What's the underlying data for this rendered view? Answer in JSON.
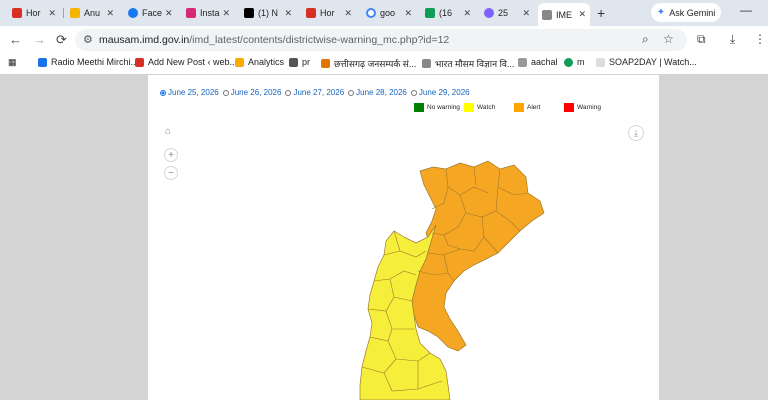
{
  "browser": {
    "tabs": [
      {
        "label": "Hor",
        "color": "#d93025"
      },
      {
        "label": "Anu",
        "color": "#f4b400"
      },
      {
        "label": "Face",
        "color": "#1877f2"
      },
      {
        "label": "Insta",
        "color": "#d62976"
      },
      {
        "label": "(1) N",
        "color": "#000000"
      },
      {
        "label": "Hor",
        "color": "#d93025"
      },
      {
        "label": "goo",
        "color": "#4285f4"
      },
      {
        "label": "(16",
        "color": "#0f9d58"
      },
      {
        "label": "25",
        "color": "#7b61ff"
      },
      {
        "label": "IME",
        "color": "#888888",
        "active": true
      }
    ],
    "new_tab": "+",
    "gemini_label": "Ask Gemini",
    "minimize": "—",
    "url_host": "mausam.imd.gov.in",
    "url_path": "/imd_latest/contents/districtwise-warning_mc.php?id=12",
    "nav": {
      "back": "←",
      "forward": "→",
      "reload": "⟳"
    }
  },
  "bookmarks": [
    {
      "label": "Radio Meethi Mirchi...",
      "color": "#1a73e8"
    },
    {
      "label": "Add New Post ‹ web...",
      "color": "#d93025"
    },
    {
      "label": "Analytics",
      "color": "#f9ab00"
    },
    {
      "label": "pr",
      "color": "#555555"
    },
    {
      "label": "छत्तीसगढ़ जनसम्पर्क सं...",
      "color": "#e37400"
    },
    {
      "label": "भारत मौसम विज्ञान वि...",
      "color": "#888888"
    },
    {
      "label": "aachal",
      "color": "#999999"
    },
    {
      "label": "m",
      "color": "#0f9d58"
    },
    {
      "label": "SOAP2DAY | Watch...",
      "color": "#bbbbbb"
    }
  ],
  "page": {
    "dates": [
      {
        "label": "June 25, 2026",
        "selected": true
      },
      {
        "label": "June 26, 2026",
        "selected": false
      },
      {
        "label": "June 27, 2026",
        "selected": false
      },
      {
        "label": "June 28, 2026",
        "selected": false
      },
      {
        "label": "June 29, 2026",
        "selected": false
      }
    ],
    "legend": [
      {
        "label": "No warning",
        "color": "#008000"
      },
      {
        "label": "Watch",
        "color": "#ffff00"
      },
      {
        "label": "Alert",
        "color": "#ffa500"
      },
      {
        "label": "Warning",
        "color": "#ff0000"
      }
    ],
    "map_colors": {
      "alert": "#f5a623",
      "watch": "#f5ee3a",
      "border": "#a07a2c"
    }
  }
}
